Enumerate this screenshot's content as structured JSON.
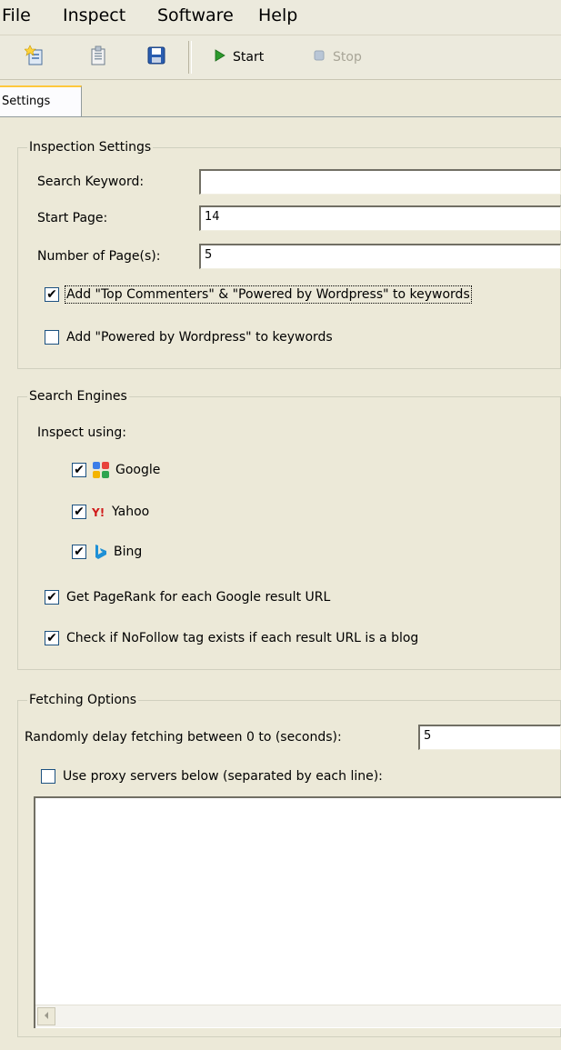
{
  "menu": [
    "File",
    "Inspect",
    "Software",
    "Help"
  ],
  "toolbar": {
    "new_icon": "new-document-icon",
    "open_icon": "open-icon",
    "save_icon": "save-icon",
    "start_label": "Start",
    "stop_label": "Stop"
  },
  "tabs": {
    "settings": "Settings"
  },
  "inspection": {
    "title": "Inspection Settings",
    "search_keyword_label": "Search Keyword:",
    "search_keyword_value": "",
    "start_page_label": "Start Page:",
    "start_page_value": "14",
    "num_pages_label": "Number of Page(s):",
    "num_pages_value": "5",
    "option_top_commenters": "Add \"Top Commenters\" & \"Powered by Wordpress\" to keywords",
    "option_top_commenters_checked": true,
    "option_powered_by": "Add \"Powered by Wordpress\" to keywords",
    "option_powered_by_checked": false
  },
  "engines": {
    "title": "Search Engines",
    "inspect_using": "Inspect using:",
    "items": [
      {
        "label": "Google",
        "icon": "google-icon",
        "checked": true
      },
      {
        "label": "Yahoo",
        "icon": "yahoo-icon",
        "checked": true
      },
      {
        "label": "Bing",
        "icon": "bing-icon",
        "checked": true
      }
    ],
    "pagerank_label": "Get PageRank for each Google result URL",
    "pagerank_checked": true,
    "nofollow_label": "Check if NoFollow tag exists if each result URL is a blog",
    "nofollow_checked": true
  },
  "fetching": {
    "title": "Fetching Options",
    "delay_label": "Randomly delay fetching between 0 to (seconds):",
    "delay_value": "5",
    "proxy_label": "Use proxy servers below (separated by each line):",
    "proxy_checked": false,
    "proxy_text": ""
  },
  "check_mark": "✔"
}
